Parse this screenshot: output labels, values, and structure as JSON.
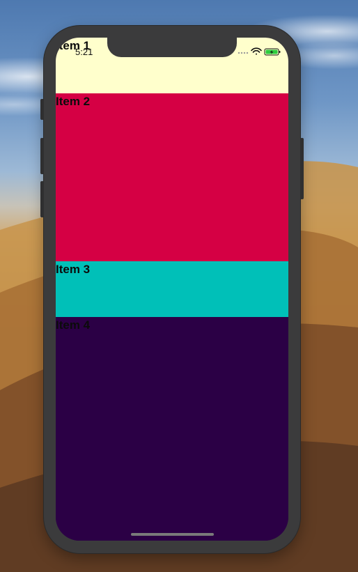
{
  "status_bar": {
    "time": "5:21",
    "signal_icon": "cellular-dots-icon",
    "wifi_icon": "wifi-icon",
    "battery_icon": "battery-charging-icon",
    "battery_color": "#2ecc40"
  },
  "items": [
    {
      "label": "Item 1",
      "color": "#ffffcc"
    },
    {
      "label": "Item 2",
      "color": "#d50044"
    },
    {
      "label": "Item 3",
      "color": "#00c0b8"
    },
    {
      "label": "Item 4",
      "color": "#2b0045"
    }
  ],
  "device": {
    "frame_color": "#3b3b3c"
  }
}
